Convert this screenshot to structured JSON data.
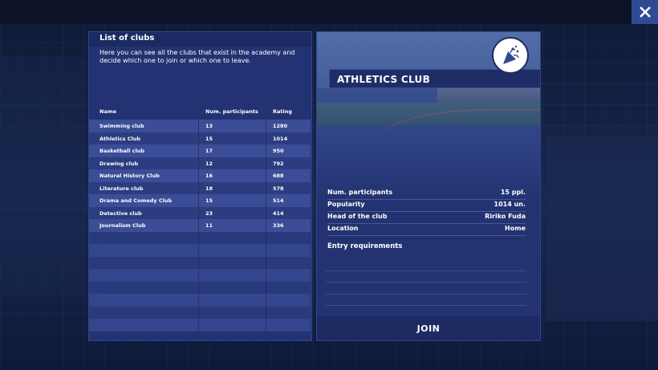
{
  "close_button": {
    "icon": "close-icon"
  },
  "club_list": {
    "title": "List of clubs",
    "description": "Here you can see all the clubs that exist in the academy and decide which one to join or which one to leave.",
    "columns": [
      "Name",
      "Num. participants",
      "Rating"
    ],
    "rows": [
      {
        "name": "Swimming club",
        "participants": "13",
        "rating": "1280"
      },
      {
        "name": "Athletics Club",
        "participants": "15",
        "rating": "1014"
      },
      {
        "name": "Basketball club",
        "participants": "17",
        "rating": "950"
      },
      {
        "name": "Drawing club",
        "participants": "12",
        "rating": "792"
      },
      {
        "name": "Natural History Club",
        "participants": "16",
        "rating": "688"
      },
      {
        "name": "Literature club",
        "participants": "18",
        "rating": "578"
      },
      {
        "name": "Drama and Comedy Club",
        "participants": "15",
        "rating": "514"
      },
      {
        "name": "Detective club",
        "participants": "23",
        "rating": "414"
      },
      {
        "name": "Journalism Club",
        "participants": "11",
        "rating": "336"
      }
    ]
  },
  "club_detail": {
    "title": "ATHLETICS CLUB",
    "badge_icon": "party-popper-icon",
    "info": [
      {
        "label": "Num. participants",
        "value": "15 ppl."
      },
      {
        "label": "Popularity",
        "value": "1014 un."
      },
      {
        "label": "Head of the club",
        "value": "Ririko Fuda"
      },
      {
        "label": "Location",
        "value": "Home"
      }
    ],
    "requirements_title": "Entry requirements",
    "join_label": "JOIN"
  }
}
